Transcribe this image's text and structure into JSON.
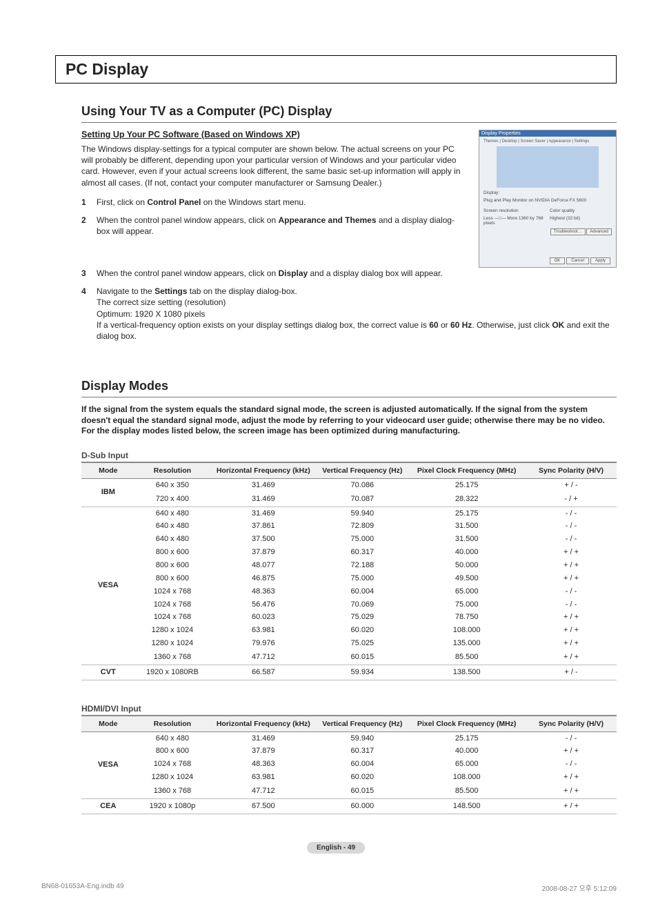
{
  "title": "PC Display",
  "using": {
    "heading": "Using Your TV as a Computer (PC) Display",
    "subheading": "Setting Up Your PC Software (Based on Windows XP)",
    "intro": "The Windows display-settings for a typical computer are shown below. The actual screens on your PC will probably be different, depending upon your particular version of Windows and your particular video card. However, even if your actual screens look different, the same basic set-up information will apply in almost all cases. (If not, contact your computer manufacturer or Samsung Dealer.)",
    "steps": {
      "s1_num": "1",
      "s1_a": "First, click on ",
      "s1_b": "Control Panel",
      "s1_c": " on the Windows start menu.",
      "s2_num": "2",
      "s2_a": "When the control panel window appears, click on ",
      "s2_b": "Appearance and Themes",
      "s2_c": " and a display dialog-box will appear.",
      "s3_num": "3",
      "s3_a": "When the control panel window appears, click on ",
      "s3_b": "Display",
      "s3_c": " and a display dialog box will appear.",
      "s4_num": "4",
      "s4_a": "Navigate to the ",
      "s4_b": "Settings",
      "s4_c": " tab on the display dialog-box.",
      "s4_line2": "The correct size setting (resolution)",
      "s4_line3": "Optimum: 1920 X 1080 pixels",
      "s4_line4a": "If a vertical-frequency option exists on your display settings dialog box, the correct value is ",
      "s4_line4b": "60",
      "s4_line4c": " or ",
      "s4_line4d": "60 Hz",
      "s4_line4e": ". Otherwise, just click ",
      "s4_line4f": "OK",
      "s4_line4g": " and exit the dialog box."
    }
  },
  "dialog": {
    "title": "Display Properties",
    "tabs": "Themes | Desktop | Screen Saver | Appearance | Settings",
    "display_label": "Display:",
    "display_text": "Plug and Play Monitor on NVIDIA GeForce FX 5600",
    "res_label": "Screen resolution",
    "res_text": "Less —□— More   1360 by 768 pixels",
    "quality_label": "Color quality",
    "quality_text": "Highest (32 bit)",
    "btn_troubleshoot": "Troubleshoot…",
    "btn_advanced": "Advanced",
    "btn_ok": "OK",
    "btn_cancel": "Cancel",
    "btn_apply": "Apply"
  },
  "modes": {
    "heading": "Display Modes",
    "intro": "If the signal from the system equals the standard signal mode, the screen is adjusted automatically. If the signal from the system doesn't equal the standard signal mode, adjust the mode by referring to your videocard user guide; otherwise there may be no video. For the display modes listed below, the screen image has been optimized during manufacturing.",
    "cols": {
      "mode": "Mode",
      "res": "Resolution",
      "hfreq": "Horizontal Frequency (kHz)",
      "vfreq": "Vertical Frequency (Hz)",
      "pclk": "Pixel Clock Frequency (MHz)",
      "sync": "Sync Polarity (H/V)"
    },
    "dsub_caption": "D-Sub Input",
    "hdmi_caption": "HDMI/DVI Input"
  },
  "chart_data": {
    "type": "table",
    "dsub": [
      {
        "mode": "IBM",
        "rows": [
          {
            "res": "640 x 350",
            "h": "31.469",
            "v": "70.086",
            "p": "25.175",
            "s": "+ / -"
          },
          {
            "res": "720 x 400",
            "h": "31.469",
            "v": "70.087",
            "p": "28.322",
            "s": "- / +"
          }
        ]
      },
      {
        "mode": "VESA",
        "rows": [
          {
            "res": "640 x 480",
            "h": "31.469",
            "v": "59.940",
            "p": "25.175",
            "s": "- / -"
          },
          {
            "res": "640 x 480",
            "h": "37.861",
            "v": "72.809",
            "p": "31.500",
            "s": "- / -"
          },
          {
            "res": "640 x 480",
            "h": "37.500",
            "v": "75.000",
            "p": "31.500",
            "s": "- / -"
          },
          {
            "res": "800 x 600",
            "h": "37.879",
            "v": "60.317",
            "p": "40.000",
            "s": "+ / +"
          },
          {
            "res": "800 x 600",
            "h": "48.077",
            "v": "72.188",
            "p": "50.000",
            "s": "+ / +"
          },
          {
            "res": "800 x 600",
            "h": "46.875",
            "v": "75.000",
            "p": "49.500",
            "s": "+ / +"
          },
          {
            "res": "1024 x 768",
            "h": "48.363",
            "v": "60.004",
            "p": "65.000",
            "s": "- / -"
          },
          {
            "res": "1024 x 768",
            "h": "56.476",
            "v": "70.069",
            "p": "75.000",
            "s": "- / -"
          },
          {
            "res": "1024 x 768",
            "h": "60.023",
            "v": "75.029",
            "p": "78.750",
            "s": "+ / +"
          },
          {
            "res": "1280 x 1024",
            "h": "63.981",
            "v": "60.020",
            "p": "108.000",
            "s": "+ / +"
          },
          {
            "res": "1280 x 1024",
            "h": "79.976",
            "v": "75.025",
            "p": "135.000",
            "s": "+ / +"
          },
          {
            "res": "1360 x 768",
            "h": "47.712",
            "v": "60.015",
            "p": "85.500",
            "s": "+ / +"
          }
        ]
      },
      {
        "mode": "CVT",
        "rows": [
          {
            "res": "1920 x 1080RB",
            "h": "66.587",
            "v": "59.934",
            "p": "138.500",
            "s": "+ / -"
          }
        ]
      }
    ],
    "hdmi": [
      {
        "mode": "VESA",
        "rows": [
          {
            "res": "640 x 480",
            "h": "31.469",
            "v": "59.940",
            "p": "25.175",
            "s": "- / -"
          },
          {
            "res": "800 x 600",
            "h": "37.879",
            "v": "60.317",
            "p": "40.000",
            "s": "+ / +"
          },
          {
            "res": "1024 x 768",
            "h": "48.363",
            "v": "60.004",
            "p": "65.000",
            "s": "- / -"
          },
          {
            "res": "1280 x 1024",
            "h": "63.981",
            "v": "60.020",
            "p": "108.000",
            "s": "+ / +"
          },
          {
            "res": "1360 x 768",
            "h": "47.712",
            "v": "60.015",
            "p": "85.500",
            "s": "+ / +"
          }
        ]
      },
      {
        "mode": "CEA",
        "rows": [
          {
            "res": "1920 x 1080p",
            "h": "67.500",
            "v": "60.000",
            "p": "148.500",
            "s": "+ / +"
          }
        ]
      }
    ]
  },
  "footer": {
    "lang_page": "English - 49",
    "doc_ref": "BN68-01653A-Eng.indb   49",
    "timestamp": "2008-08-27   오후 5:12:09"
  }
}
